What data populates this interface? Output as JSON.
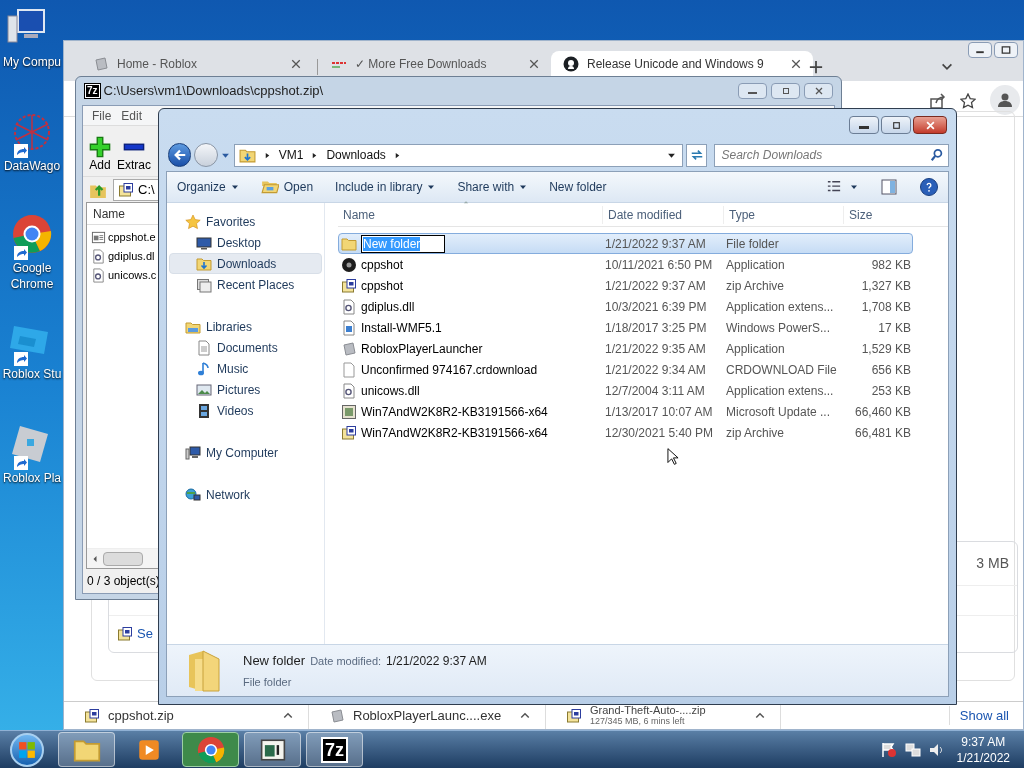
{
  "desktop_icons": [
    {
      "label": "My Compu",
      "kind": "computer",
      "shortcut": false
    },
    {
      "label": "DataWago",
      "kind": "web",
      "shortcut": true
    },
    {
      "label": "Google Chrome",
      "kind": "chrome",
      "shortcut": true
    },
    {
      "label": "Roblox Stu",
      "kind": "studio",
      "shortcut": true
    },
    {
      "label": "Roblox Pla",
      "kind": "player",
      "shortcut": true
    }
  ],
  "browser": {
    "tabs": [
      {
        "title": "Home - Roblox",
        "kind": "roblox",
        "selected": false
      },
      {
        "title": "✓ More Free Downloads",
        "kind": "dashes",
        "selected": false
      },
      {
        "title": "Release Unicode and Windows 9",
        "kind": "github",
        "selected": true
      }
    ],
    "page_fragments": {
      "size_text": "3 MB",
      "link_text": "Se"
    },
    "downloads": [
      {
        "name": "cppshot.zip",
        "kind": "zip"
      },
      {
        "name": "RobloxPlayerLaunc....exe",
        "kind": "roblox"
      },
      {
        "name": "Grand-Theft-Auto-....zip",
        "kind": "zip",
        "status": "127/345 MB, 6 mins left"
      }
    ],
    "show_all": "Show all"
  },
  "archiver": {
    "logo": "7z",
    "title": "C:\\Users\\vm1\\Downloads\\cppshot.zip\\",
    "menu": [
      "File",
      "Edit"
    ],
    "toolbar": [
      {
        "label": "Add",
        "kind": "add"
      },
      {
        "label": "Extrac",
        "kind": "extract"
      }
    ],
    "address": "C:\\",
    "column": "Name",
    "files": [
      {
        "name": "cppshot.e",
        "kind": "exe"
      },
      {
        "name": "gdiplus.dl",
        "kind": "dll"
      },
      {
        "name": "unicows.c",
        "kind": "dll"
      }
    ],
    "status": "0 / 3 object(s)"
  },
  "explorer": {
    "breadcrumbs": [
      "VM1",
      "Downloads"
    ],
    "search": {
      "placeholder": "Search Downloads"
    },
    "toolbar": [
      {
        "label": "Organize",
        "dropdown": true,
        "kind": "plain"
      },
      {
        "label": "Open",
        "dropdown": false,
        "kind": "open"
      },
      {
        "label": "Include in library",
        "dropdown": true,
        "kind": "plain"
      },
      {
        "label": "Share with",
        "dropdown": true,
        "kind": "plain"
      },
      {
        "label": "New folder",
        "dropdown": false,
        "kind": "plain"
      }
    ],
    "nav": [
      {
        "label": "Favorites",
        "kind": "star",
        "children": [
          {
            "label": "Desktop",
            "kind": "desktop",
            "selected": false
          },
          {
            "label": "Downloads",
            "kind": "downloads",
            "selected": true
          },
          {
            "label": "Recent Places",
            "kind": "recent",
            "selected": false
          }
        ]
      },
      {
        "label": "Libraries",
        "kind": "libraries",
        "children": [
          {
            "label": "Documents",
            "kind": "document",
            "selected": false
          },
          {
            "label": "Music",
            "kind": "music",
            "selected": false
          },
          {
            "label": "Pictures",
            "kind": "pictures",
            "selected": false
          },
          {
            "label": "Videos",
            "kind": "videos",
            "selected": false
          }
        ]
      },
      {
        "label": "My Computer",
        "kind": "computer"
      },
      {
        "label": "Network",
        "kind": "network"
      }
    ],
    "columns": [
      "Name",
      "Date modified",
      "Type",
      "Size"
    ],
    "rows": [
      {
        "name": "New folder",
        "date": "1/21/2022 9:37 AM",
        "type": "File folder",
        "size": "",
        "kind": "folder",
        "selected": true,
        "editing": true
      },
      {
        "name": "cppshot",
        "date": "10/11/2021 6:50 PM",
        "type": "Application",
        "size": "982 KB",
        "kind": "disc",
        "selected": false,
        "editing": false
      },
      {
        "name": "cppshot",
        "date": "1/21/2022 9:37 AM",
        "type": "zip Archive",
        "size": "1,327 KB",
        "kind": "zip",
        "selected": false,
        "editing": false
      },
      {
        "name": "gdiplus.dll",
        "date": "10/3/2021 6:39 PM",
        "type": "Application extens...",
        "size": "1,708 KB",
        "kind": "dll",
        "selected": false,
        "editing": false
      },
      {
        "name": "Install-WMF5.1",
        "date": "1/18/2017 3:25 PM",
        "type": "Windows PowerS...",
        "size": "17 KB",
        "kind": "script",
        "selected": false,
        "editing": false
      },
      {
        "name": "RobloxPlayerLauncher",
        "date": "1/21/2022 9:35 AM",
        "type": "Application",
        "size": "1,529 KB",
        "kind": "roblox",
        "selected": false,
        "editing": false
      },
      {
        "name": "Unconfirmed 974167.crdownload",
        "date": "1/21/2022 9:34 AM",
        "type": "CRDOWNLOAD File",
        "size": "656 KB",
        "kind": "blank",
        "selected": false,
        "editing": false
      },
      {
        "name": "unicows.dll",
        "date": "12/7/2004 3:11 AM",
        "type": "Application extens...",
        "size": "253 KB",
        "kind": "dll",
        "selected": false,
        "editing": false
      },
      {
        "name": "Win7AndW2K8R2-KB3191566-x64",
        "date": "1/13/2017 10:07 AM",
        "type": "Microsoft Update ...",
        "size": "66,460 KB",
        "kind": "installer",
        "selected": false,
        "editing": false
      },
      {
        "name": "Win7AndW2K8R2-KB3191566-x64",
        "date": "12/30/2021 5:40 PM",
        "type": "zip Archive",
        "size": "66,481 KB",
        "kind": "zip",
        "selected": false,
        "editing": false
      }
    ],
    "details": {
      "name": "New folder",
      "date_label": "Date modified:",
      "date": "1/21/2022 9:37 AM",
      "type": "File folder"
    }
  },
  "taskbar": {
    "apps": [
      {
        "kind": "explorer",
        "active": true
      },
      {
        "kind": "media",
        "active": false
      },
      {
        "kind": "chrome",
        "active": true
      },
      {
        "kind": "app",
        "active": true
      },
      {
        "kind": "archiver",
        "active": true,
        "logo": "7z"
      }
    ],
    "time": "9:37 AM",
    "date": "1/21/2022"
  }
}
